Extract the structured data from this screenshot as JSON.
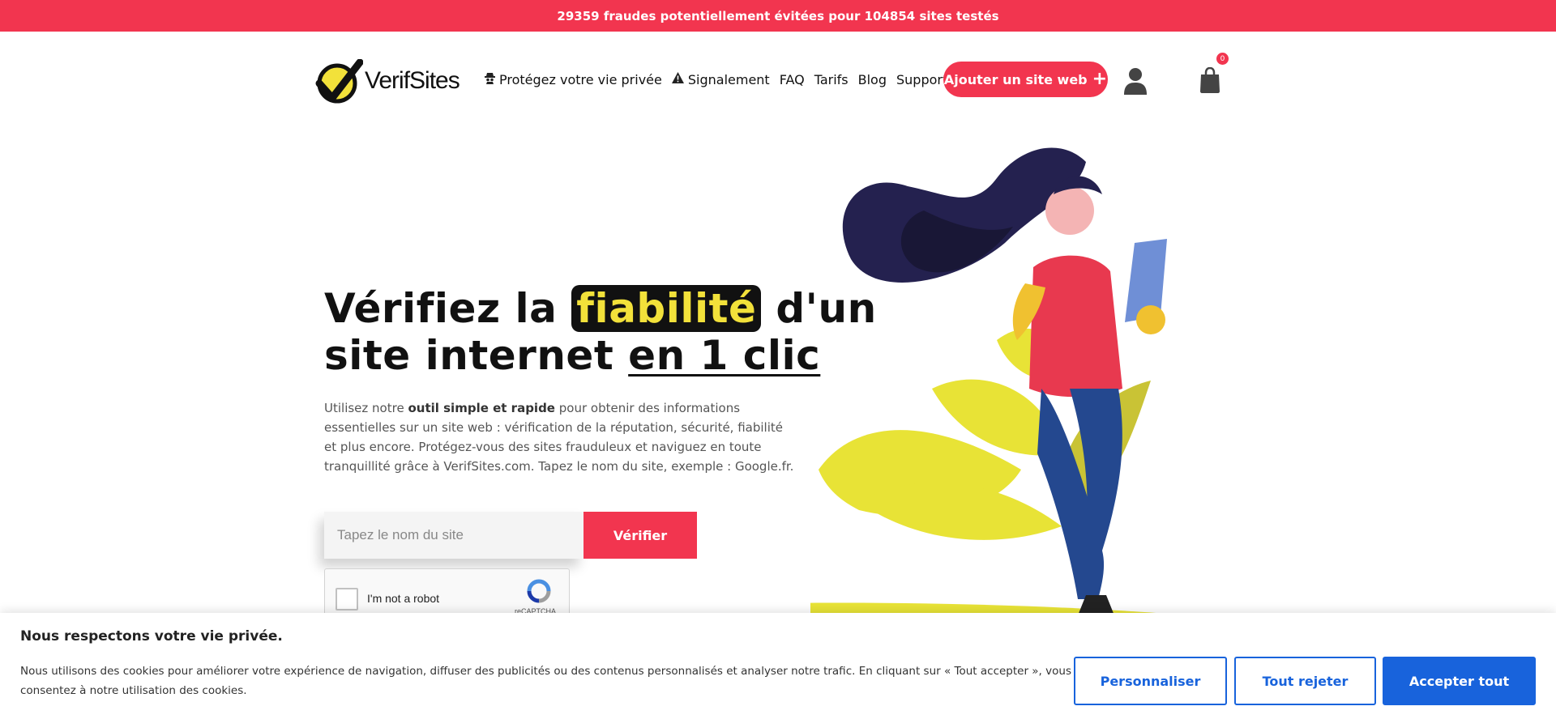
{
  "banner": {
    "text": "29359 fraudes potentiellement évitées pour 104854 sites testés"
  },
  "header": {
    "logo_text": "VerifSites",
    "nav": [
      {
        "label": "Protégez votre vie privée",
        "icon": "spy-icon"
      },
      {
        "label": "Signalement",
        "icon": "warning-icon"
      },
      {
        "label": "FAQ"
      },
      {
        "label": "Tarifs"
      },
      {
        "label": "Blog"
      },
      {
        "label": "Support"
      }
    ],
    "add_site_label": "Ajouter un site web",
    "cart_count": "0"
  },
  "hero": {
    "title_part1": "Vérifiez la",
    "title_highlight": "fiabilité",
    "title_part2": "d'un",
    "title_line2": "site internet",
    "title_underline": "en 1 clic",
    "desc_prefix": "Utilisez notre",
    "desc_bold": "outil simple et rapide",
    "desc_suffix": "pour obtenir des informations essentielles sur un site web : vérification de la réputation, sécurité, fiabilité et plus encore. Protégez-vous des sites frauduleux et naviguez en toute tranquillité grâce à VerifSites.com. Tapez le nom du site, exemple : Google.fr.",
    "search_placeholder": "Tapez le nom du site",
    "search_value": "",
    "verify_label": "Vérifier"
  },
  "captcha": {
    "label": "I'm not a robot",
    "brand": "reCAPTCHA"
  },
  "cookie": {
    "title": "Nous respectons votre vie privée.",
    "text": "Nous utilisons des cookies pour améliorer votre expérience de navigation, diffuser des publicités ou des contenus personnalisés et analyser notre trafic. En cliquant sur « Tout accepter », vous consentez à notre utilisation des cookies.",
    "customize_label": "Personnaliser",
    "reject_label": "Tout rejeter",
    "accept_label": "Accepter tout"
  },
  "colors": {
    "brand_red": "#f2354f",
    "accent_yellow": "#f2e13a",
    "cookie_blue": "#1863dc"
  }
}
